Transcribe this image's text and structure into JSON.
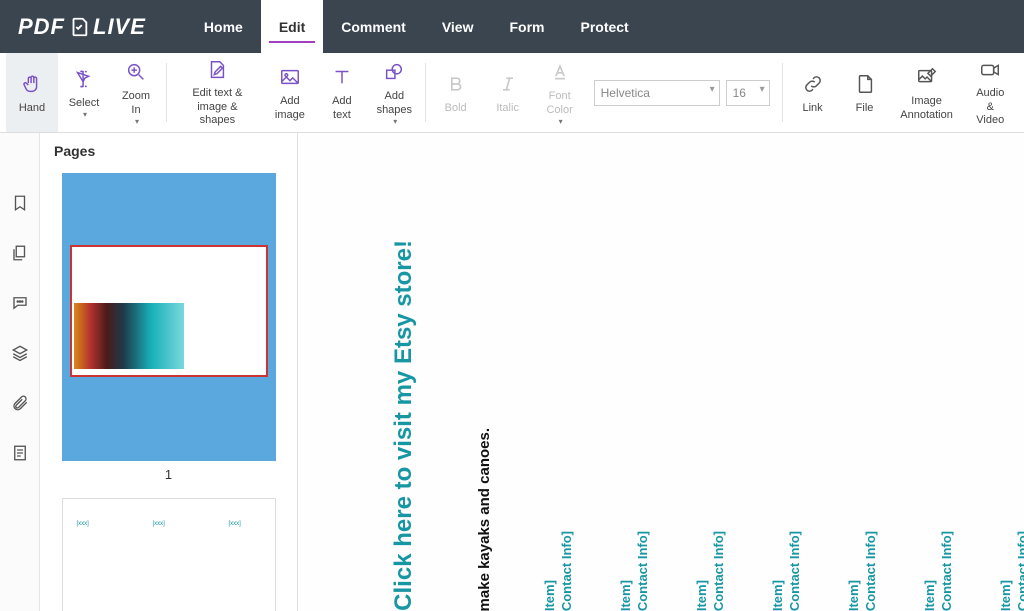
{
  "app": {
    "logo_a": "PDF",
    "logo_b": "LIVE"
  },
  "menu": {
    "home": "Home",
    "edit": "Edit",
    "comment": "Comment",
    "view": "View",
    "form": "Form",
    "protect": "Protect"
  },
  "toolbar": {
    "hand": "Hand",
    "select": "Select",
    "zoom_in": "Zoom\nIn",
    "edit_text_image_shapes": "Edit text &\nimage & shapes",
    "add_image": "Add\nimage",
    "add_text": "Add\ntext",
    "add_shapes": "Add\nshapes",
    "bold": "Bold",
    "italic": "Italic",
    "font_color": "Font\nColor",
    "link": "Link",
    "file": "File",
    "image_annotation": "Image\nAnnotation",
    "audio_video": "Audio\n& Video",
    "font_family": "Helvetica",
    "font_size": "16"
  },
  "pages": {
    "title": "Pages",
    "page1_num": "1"
  },
  "doc": {
    "heading": "Click here to visit my Etsy store!",
    "sub": "make kayaks and canoes.",
    "stub_item": "Item]",
    "stub_contact": "Contact Info]"
  }
}
